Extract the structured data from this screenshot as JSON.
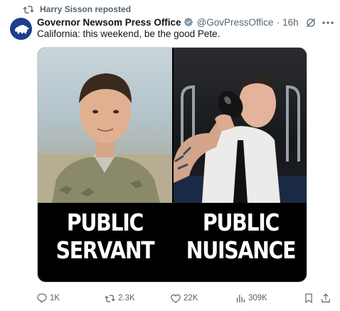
{
  "repost": {
    "text": "Harry Sisson reposted"
  },
  "post": {
    "author_name": "Governor Newsom Press Office",
    "handle": "@GovPressOffice",
    "separator": "·",
    "time": "16h",
    "text": "California: this weekend, be the good Pete."
  },
  "media": {
    "left_caption": [
      "PUBLIC",
      "SERVANT"
    ],
    "right_caption": [
      "PUBLIC",
      "NUISANCE"
    ]
  },
  "actions": {
    "replies": "1K",
    "reposts": "2.3K",
    "likes": "22K",
    "views": "309K"
  },
  "icons": {
    "repost": "repost-icon",
    "verified": "verified-badge-icon",
    "grok": "grok-icon",
    "more": "more-icon",
    "reply": "reply-icon",
    "like": "heart-icon",
    "views": "views-icon",
    "bookmark": "bookmark-icon",
    "share": "share-icon"
  },
  "colors": {
    "secondary_text": "#536471",
    "verified_badge": "#829aab",
    "avatar_bg": "#1d3f8c"
  }
}
